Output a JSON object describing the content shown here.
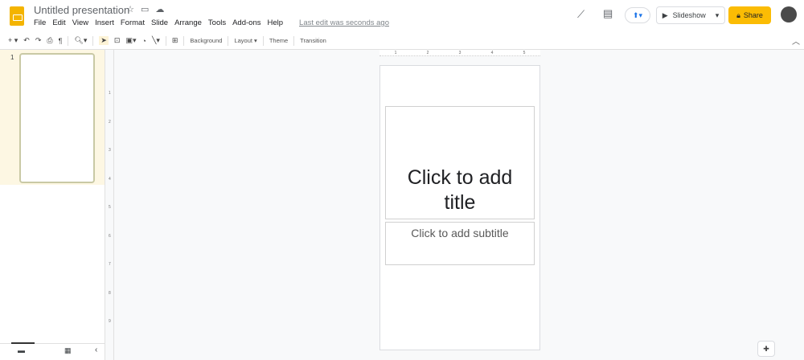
{
  "header": {
    "title": "Untitled presentation",
    "menu": [
      "File",
      "Edit",
      "View",
      "Insert",
      "Format",
      "Slide",
      "Arrange",
      "Tools",
      "Add-ons",
      "Help"
    ],
    "last_edit": "Last edit was seconds ago",
    "slideshow": "Slideshow",
    "share": "Share"
  },
  "toolbar": {
    "background": "Background",
    "layout": "Layout",
    "theme": "Theme",
    "transition": "Transition"
  },
  "filmstrip": {
    "slide_number": "1"
  },
  "ruler": {
    "h": [
      "1",
      "2",
      "3",
      "4",
      "5"
    ],
    "v": [
      "1",
      "2",
      "3",
      "4",
      "5",
      "6",
      "7",
      "8",
      "9"
    ]
  },
  "slide": {
    "title_placeholder": "Click to add title",
    "subtitle_placeholder": "Click to add subtitle"
  },
  "colors": {
    "share": "#fbbc04",
    "logo": "#f4b400"
  }
}
